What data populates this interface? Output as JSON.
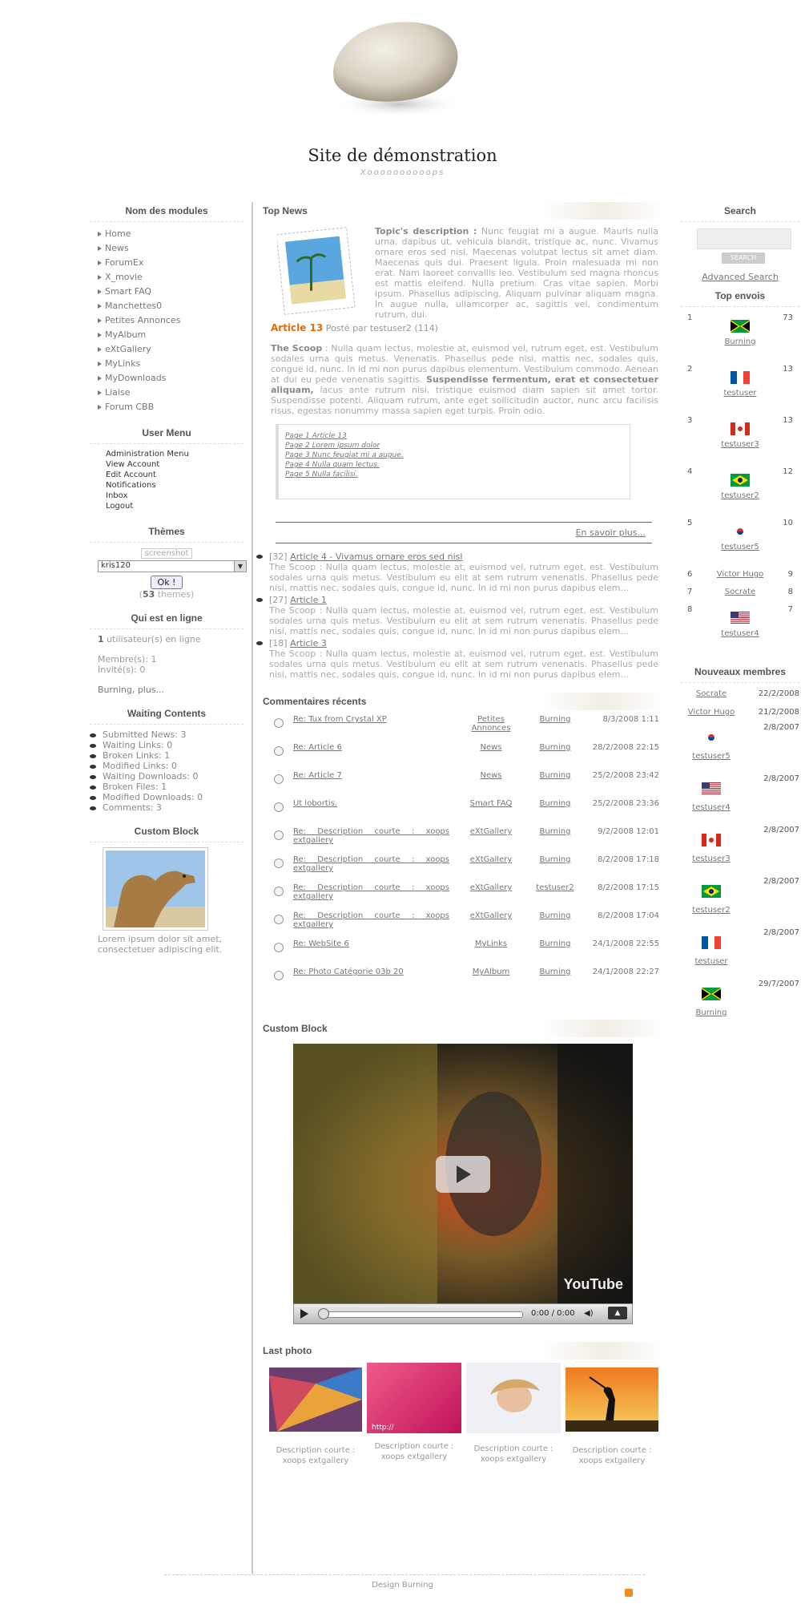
{
  "header": {
    "title": "Site de démonstration",
    "slogan": "Xoooooooooops"
  },
  "left": {
    "modules_title": "Nom des modules",
    "modules": [
      "Home",
      "News",
      "ForumEx",
      "X_movie",
      "Smart FAQ",
      "Manchettes0",
      "Petites Annonces",
      "MyAlbum",
      "eXtGallery",
      "MyLinks",
      "MyDownloads",
      "Liaise",
      "Forum CBB"
    ],
    "usermenu_title": "User Menu",
    "usermenu": [
      "Administration Menu",
      "View Account",
      "Edit Account",
      "Notifications",
      "Inbox",
      "Logout"
    ],
    "themes_title": "Thèmes",
    "themes_screenshot": "screenshot",
    "themes_select": "kris120",
    "themes_button": "Ok !",
    "themes_count": "53",
    "themes_suffix": "themes",
    "online_title": "Qui est en ligne",
    "online_count": "1",
    "online_text": "utilisateur(s) en ligne",
    "members": "Membre(s): 1",
    "guests": "Invité(s): 0",
    "online_more": "Burning, plus...",
    "waiting_title": "Waiting Contents",
    "waiting": [
      {
        "label": "Submitted News:",
        "value": "3"
      },
      {
        "label": "Waiting Links:",
        "value": "0"
      },
      {
        "label": "Broken Links:",
        "value": "1"
      },
      {
        "label": "Modified Links:",
        "value": "0"
      },
      {
        "label": "Waiting Downloads:",
        "value": "0"
      },
      {
        "label": "Broken Files:",
        "value": "1"
      },
      {
        "label": "Modified Downloads:",
        "value": "0"
      },
      {
        "label": "Comments:",
        "value": "3"
      }
    ],
    "custom_title": "Custom Block",
    "custom_text": "Lorem ipsum dolor sit amet, consectetuer adipiscing elit."
  },
  "center": {
    "topnews_title": "Top News",
    "topic_desc_label": "Topic's description :",
    "topic_desc": "Nunc feugiat mi a augue. Mauris nulla urna, dapibus ut, vehicula blandit, tristique ac, nunc. Vivamus ornare eros sed nisl. Maecenas volutpat lectus sit amet diam. Maecenas quis dui. Praesent ligula. Proin malesuada mi non erat. Nam laoreet convallis leo. Vestibulum sed magna rhoncus est mattis eleifend. Nulla pretium. Cras vitae sapien. Morbi ipsum. Phasellus adipiscing. Aliquam pulvinar aliquam magna. In augue nulla, ullamcorper ac, sagittis vel, condimentum rutrum, dui.",
    "article_title": "Article 13",
    "article_meta": "Posté par testuser2 (114)",
    "scoop_label": "The Scoop",
    "scoop_text": ": Nulla quam lectus, molestie at, euismod vel, rutrum eget, est. Vestibulum sodales urna quis metus. Venenatis. Phasellus pede nisi, mattis nec, sodales quis, congue id, nunc. In id mi non purus dapibus elementum. Vestibulum commodo. Aenean at dui eu pede venenatis sagittis.",
    "scoop_bold": "Suspendisse fermentum, erat et consectetuer aliquam,",
    "scoop_text2": "lacus ante rutrum nisi, tristique euismod diam sapien sit amet tortor. Suspendisse potenti. Aliquam rutrum, ante eget sollicitudin auctor, nunc arcu facilisis risus, egestas nonummy massa sapien eget turpis. Proin odio.",
    "pages": [
      "Page 1 Article 13",
      "Page 2 Lorem ipsum dolor",
      "Page 3 Nunc feugiat mi a augue.",
      "Page 4 Nulla quam lectus.",
      "Page 5 Nulla facilisi."
    ],
    "readmore": "En savoir plus...",
    "news_list": [
      {
        "count": "[32]",
        "title": "Article 4 - Vivamus ornare eros sed nisl",
        "text": "The Scoop : Nulla quam lectus, molestie at, euismod vel, rutrum eget, est. Vestibulum sodales urna quis metus. Vestibulum eu elit at sem rutrum venenatis. Phasellus pede nisi, mattis nec, sodales quis, congue id, nunc. In id mi non purus dapibus elem..."
      },
      {
        "count": "[27]",
        "title": "Article 1",
        "text": "The Scoop : Nulla quam lectus, molestie at, euismod vel, rutrum eget, est. Vestibulum sodales urna quis metus. Vestibulum eu elit at sem rutrum venenatis. Phasellus pede nisi, mattis nec, sodales quis, congue id, nunc. In id mi non purus dapibus elem..."
      },
      {
        "count": "[18]",
        "title": "Article 3",
        "text": "The Scoop : Nulla quam lectus, molestie at, euismod vel, rutrum eget, est. Vestibulum sodales urna quis metus. Vestibulum eu elit at sem rutrum venenatis. Phasellus pede nisi, mattis nec, sodales quis, congue id, nunc. In id mi non purus dapibus elem..."
      }
    ],
    "comments_title": "Commentaires récents",
    "comments": [
      {
        "title": "Re: Tux from Crystal XP",
        "module": "Petites Annonces",
        "poster": "Burning",
        "date": "8/3/2008 1:11"
      },
      {
        "title": "Re: Article 6",
        "module": "News",
        "poster": "Burning",
        "date": "28/2/2008 22:15"
      },
      {
        "title": "Re: Article 7",
        "module": "News",
        "poster": "Burning",
        "date": "25/2/2008 23:42"
      },
      {
        "title": "Ut lobortis.",
        "module": "Smart FAQ",
        "poster": "Burning",
        "date": "25/2/2008 23:36"
      },
      {
        "title": "Re: Description courte : xoops extgallery",
        "module": "eXtGallery",
        "poster": "Burning",
        "date": "9/2/2008 12:01"
      },
      {
        "title": "Re: Description courte : xoops extgallery",
        "module": "eXtGallery",
        "poster": "Burning",
        "date": "8/2/2008 17:18"
      },
      {
        "title": "Re: Description courte : xoops extgallery",
        "module": "eXtGallery",
        "poster": "testuser2",
        "date": "8/2/2008 17:15"
      },
      {
        "title": "Re: Description courte : xoops extgallery",
        "module": "eXtGallery",
        "poster": "Burning",
        "date": "8/2/2008 17:04"
      },
      {
        "title": "Re: WebSite 6",
        "module": "MyLinks",
        "poster": "Burning",
        "date": "24/1/2008 22:55"
      },
      {
        "title": "Re: Photo Catégorie 03b 20",
        "module": "MyAlbum",
        "poster": "Burning",
        "date": "24/1/2008 22:27"
      }
    ],
    "custom_title": "Custom Block",
    "video_time": "0:00 / 0:00",
    "video_logo": "YouTube",
    "lastphoto_title": "Last photo",
    "photo_caption": "Description courte : xoops extgallery",
    "photo_url_text": "http://"
  },
  "right": {
    "search_title": "Search",
    "search_button": "Search",
    "advanced": "Advanced Search",
    "top_title": "Top envois",
    "top": [
      {
        "rank": "1",
        "name": "Burning",
        "count": "73",
        "flag": "jamaica"
      },
      {
        "rank": "2",
        "name": "testuser",
        "count": "13",
        "flag": "france"
      },
      {
        "rank": "3",
        "name": "testuser3",
        "count": "13",
        "flag": "canada"
      },
      {
        "rank": "4",
        "name": "testuser2",
        "count": "12",
        "flag": "brazil"
      },
      {
        "rank": "5",
        "name": "testuser5",
        "count": "10",
        "flag": "korea"
      },
      {
        "rank": "6",
        "name": "Victor Hugo",
        "count": "9",
        "flag": ""
      },
      {
        "rank": "7",
        "name": "Socrate",
        "count": "8",
        "flag": ""
      },
      {
        "rank": "8",
        "name": "testuser4",
        "count": "7",
        "flag": "usa"
      }
    ],
    "new_title": "Nouveaux membres",
    "new_members": [
      {
        "name": "Socrate",
        "date": "22/2/2008",
        "flag": ""
      },
      {
        "name": "Victor Hugo",
        "date": "21/2/2008",
        "flag": ""
      },
      {
        "name": "testuser5",
        "date": "2/8/2007",
        "flag": "korea"
      },
      {
        "name": "testuser4",
        "date": "2/8/2007",
        "flag": "usa"
      },
      {
        "name": "testuser3",
        "date": "2/8/2007",
        "flag": "canada"
      },
      {
        "name": "testuser2",
        "date": "2/8/2007",
        "flag": "brazil"
      },
      {
        "name": "testuser",
        "date": "2/8/2007",
        "flag": "france"
      },
      {
        "name": "Burning",
        "date": "29/7/2007",
        "flag": "jamaica"
      }
    ]
  },
  "footer": {
    "text": "Design Burning"
  },
  "colors": {
    "accent": "#e46c0a",
    "text": "#999999",
    "title": "#555555"
  }
}
